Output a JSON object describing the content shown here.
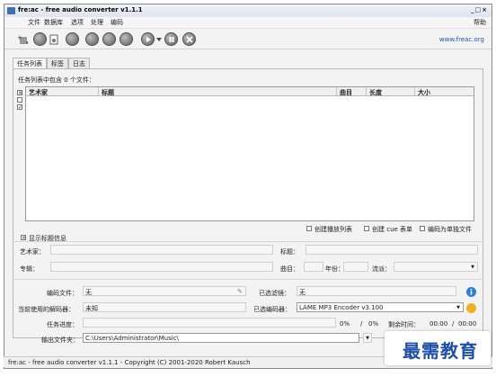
{
  "window": {
    "title": "fre:ac - free audio converter v1.1.1",
    "controls": "_□×"
  },
  "menu": [
    "文件",
    "数据库",
    "选项",
    "处理",
    "编码"
  ],
  "help": "帮助",
  "toolbar": {
    "url": "www.freac.org",
    "icons": [
      "add-icon",
      "cd-icon",
      "file-icon",
      "cddb-icon",
      "config-icon",
      "gear-icon",
      "play-icon",
      "pause-icon",
      "stop-icon"
    ]
  },
  "tabs": [
    "任务列表",
    "标签",
    "日志"
  ],
  "joblist": {
    "count_text": "任务列表中包含 0 个文件：",
    "columns": [
      "艺术家",
      "标题",
      "曲目",
      "长度",
      "大小"
    ],
    "options": [
      "创建播放列表",
      "创建 cue 表单",
      "编码为单独文件"
    ]
  },
  "info": {
    "toggle": "显示标题信息",
    "artist_label": "艺术家：",
    "title_label": "标题：",
    "album_label": "专辑：",
    "track_label": "曲目：",
    "year_label": "年份：",
    "genre_label": "流派："
  },
  "encoding": {
    "file_label": "编码文件：",
    "file_value": "无",
    "filter_label": "已选滤镜：",
    "filter_value": "无",
    "decoder_label": "当前使用的解码器：",
    "decoder_value": "未知",
    "encoder_label": "已选编码器：",
    "encoder_value": "LAME MP3 Encoder v3.100",
    "progress_label": "任务进度：",
    "progress_pct": "0%",
    "progress_slash": "/",
    "total_pct": "0%",
    "remaining_label": "剩余时间：",
    "time_value": "00:00",
    "time_total": "00:00",
    "output_label": "输出文件夹：",
    "output_value": "C:\\Users\\Administrator\\Music\\",
    "progress": 0
  },
  "status": "fre:ac - free audio converter v1.1.1 - Copyright (C) 2001-2020 Robert Kausch",
  "watermark": "最需教育",
  "colors": {
    "accent": "#1a55b0",
    "info": "#2f7fd0",
    "warn": "#f0b020"
  }
}
